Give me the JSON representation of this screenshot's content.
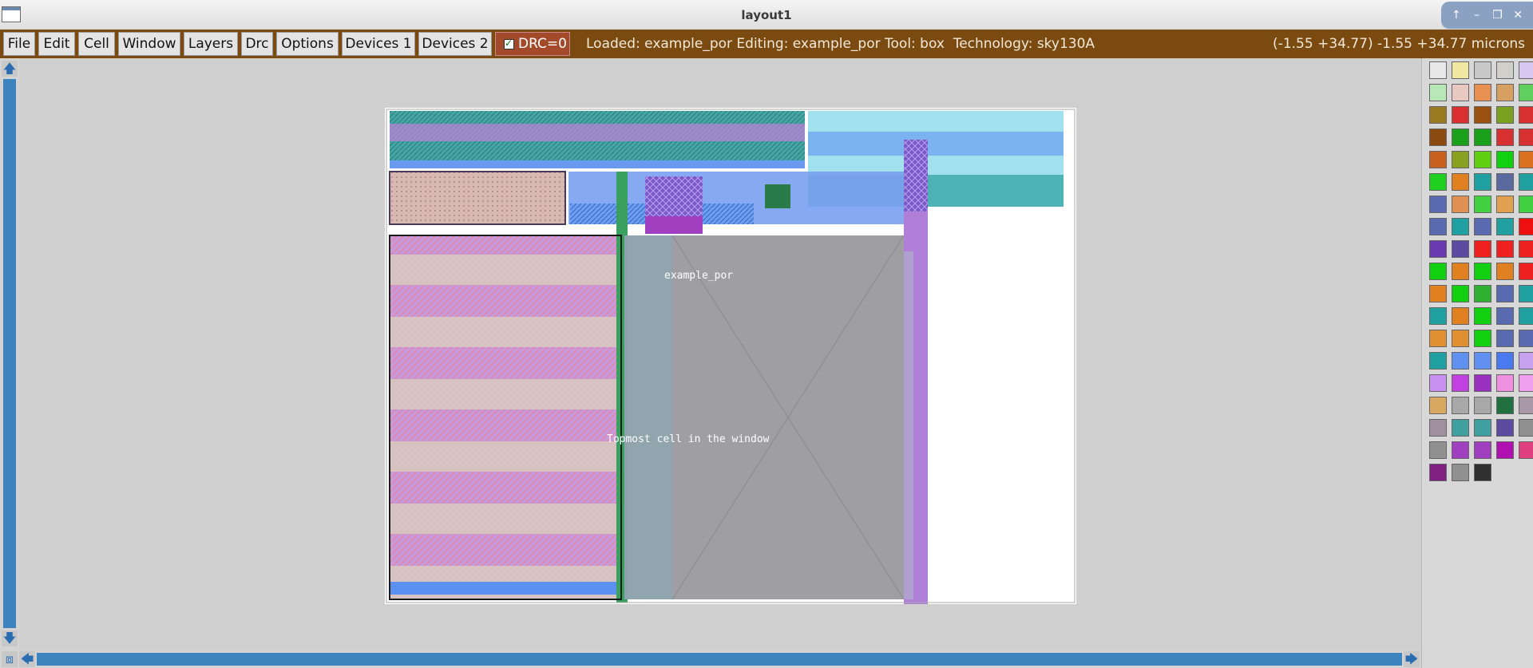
{
  "window": {
    "title": "layout1"
  },
  "menu": [
    "File",
    "Edit",
    "Cell",
    "Window",
    "Layers",
    "Drc",
    "Options",
    "Devices 1",
    "Devices 2"
  ],
  "drc": {
    "label": "DRC=0",
    "checked": true
  },
  "status": {
    "text": "Loaded: example_por Editing: example_por Tool: box  Technology: sky130A",
    "coords": "(-1.55 +34.77) -1.55 +34.77 microns"
  },
  "layout": {
    "cell_name": "example_por",
    "topmost_label": "Topmost cell in the window"
  },
  "palette_colors": [
    "#e8e8e8",
    "#f0e8a0",
    "#c8c8c8",
    "#d0d0c8",
    "#d8c8f0",
    "#b8e8b8",
    "#e8c8c0",
    "#e89050",
    "#d8a060",
    "#60d060",
    "#9a7a20",
    "#d83030",
    "#9a5010",
    "#7aa020",
    "#d83030",
    "#8a4a10",
    "#1aa01a",
    "#1aa01a",
    "#d83030",
    "#d83030",
    "#c86020",
    "#8aa020",
    "#60d010",
    "#10d010",
    "#d87020",
    "#20d020",
    "#e08020",
    "#20a0a0",
    "#5a6aa0",
    "#20a0a0",
    "#5a6ab0",
    "#e09050",
    "#40d040",
    "#e0a050",
    "#40d040",
    "#5a6ab0",
    "#20a0a0",
    "#5a6ab0",
    "#20a0a0",
    "#ee1010",
    "#6a3ab0",
    "#5a4aa0",
    "#ee2020",
    "#ee2020",
    "#ee2020",
    "#10d010",
    "#e08020",
    "#10d010",
    "#e08020",
    "#ee2020",
    "#e08020",
    "#10d010",
    "#30b030",
    "#5a6ab0",
    "#20a0a0",
    "#20a0a0",
    "#e08020",
    "#10d010",
    "#5a6ab0",
    "#20a0a0",
    "#e09030",
    "#e09030",
    "#10d010",
    "#5a6ab0",
    "#5a6ab0",
    "#20a0a0",
    "#6090f0",
    "#6090f0",
    "#4a7af0",
    "#c8a0f0",
    "#c890f0",
    "#c040e0",
    "#9a30c0",
    "#f090e0",
    "#f0a0f0",
    "#d8a860",
    "#a8a8a8",
    "#a8a8a8",
    "#207040",
    "#a898a8",
    "#a090a0",
    "#40a0a0",
    "#40a0a0",
    "#5a4aa0",
    "#909090",
    "#909090",
    "#a040c0",
    "#a040c0",
    "#b010b0",
    "#e04080",
    "#802080",
    "#909090",
    "#303030"
  ]
}
